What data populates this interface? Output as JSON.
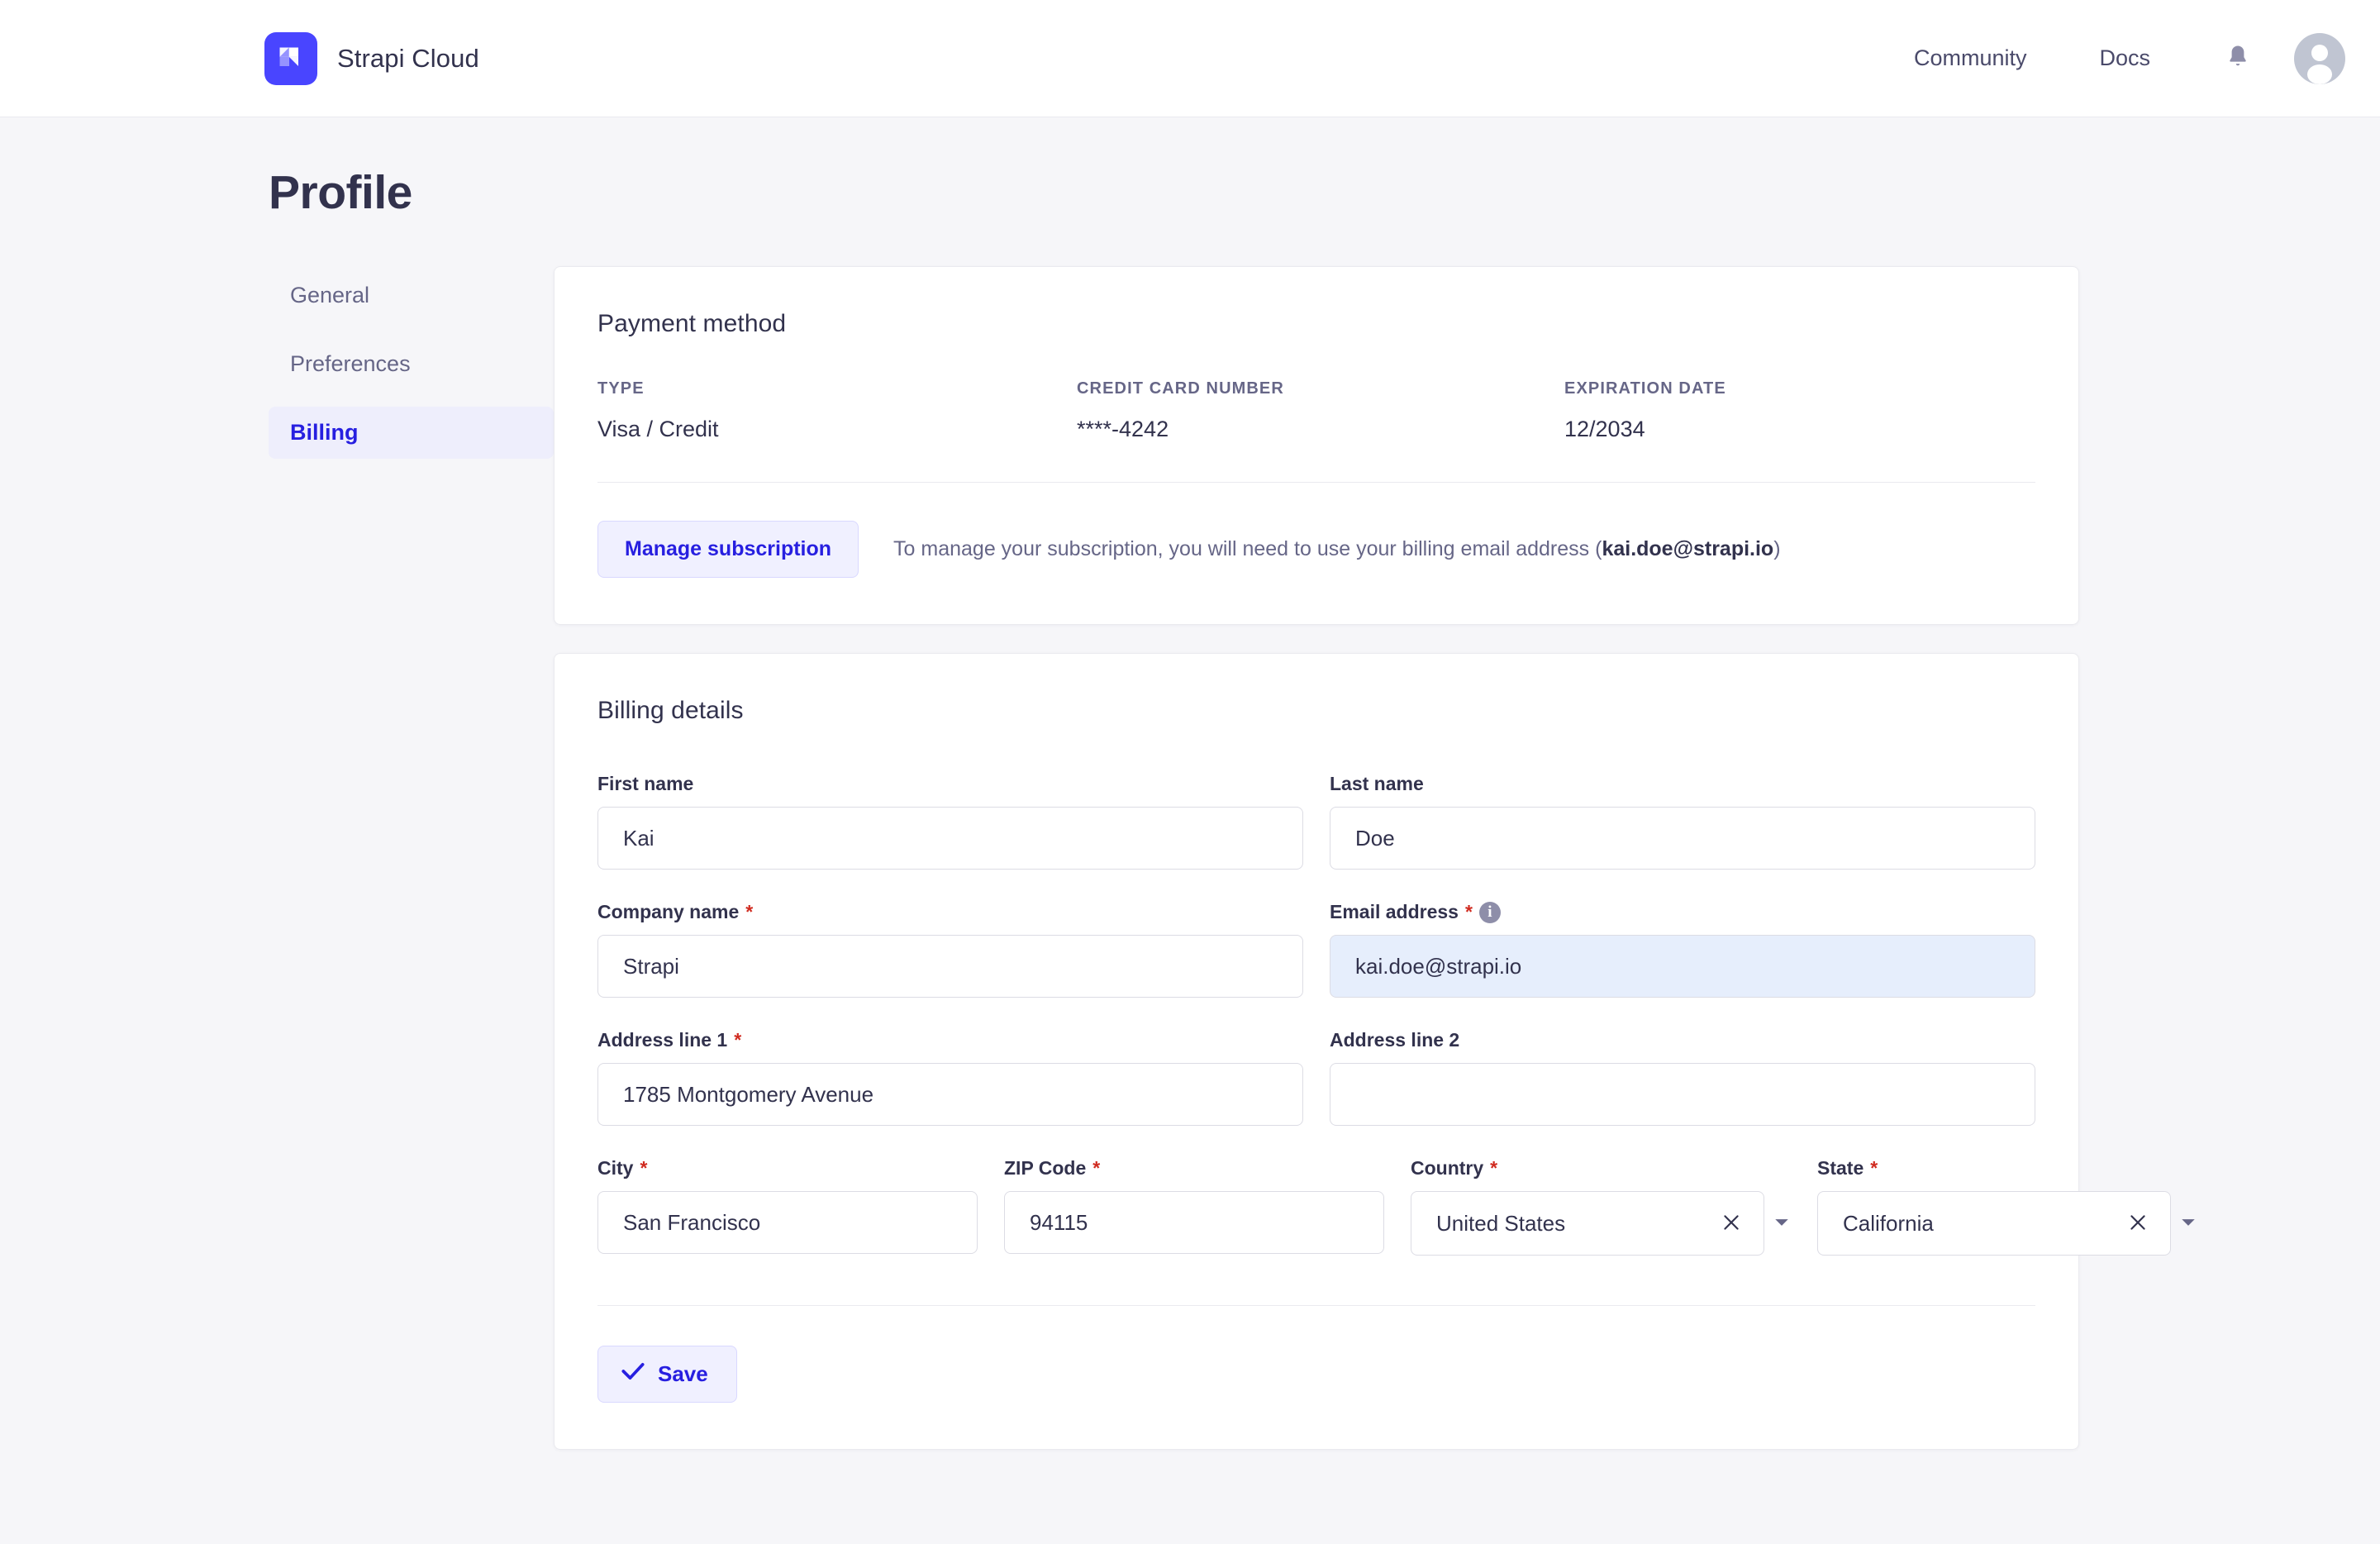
{
  "topbar": {
    "brand_name": "Strapi Cloud",
    "logo_color": "#4945ff",
    "links": [
      {
        "label": "Community"
      },
      {
        "label": "Docs"
      }
    ],
    "notifications_icon": "bell-icon",
    "avatar_icon": "user-avatar-icon"
  },
  "page": {
    "title": "Profile"
  },
  "sidebar": {
    "items": [
      {
        "label": "General",
        "active": false
      },
      {
        "label": "Preferences",
        "active": false
      },
      {
        "label": "Billing",
        "active": true
      }
    ],
    "active_color": "#271fe0",
    "active_background": "#eeeefc"
  },
  "payment_method": {
    "title": "Payment method",
    "columns": [
      {
        "label": "TYPE",
        "value": "Visa / Credit"
      },
      {
        "label": "CREDIT CARD NUMBER",
        "value": "****-4242"
      },
      {
        "label": "EXPIRATION DATE",
        "value": "12/2034"
      }
    ],
    "manage_button": "Manage subscription",
    "manage_text_prefix": "To manage your subscription, you will need to use your billing email address (",
    "manage_text_email": "kai.doe@strapi.io",
    "manage_text_suffix": ")"
  },
  "billing_details": {
    "title": "Billing details",
    "fields": {
      "first_name": {
        "label": "First name",
        "value": "Kai",
        "required": false,
        "placeholder": ""
      },
      "last_name": {
        "label": "Last name",
        "value": "Doe",
        "required": false,
        "placeholder": ""
      },
      "company_name": {
        "label": "Company name",
        "required_mark": "*",
        "value": "Strapi",
        "placeholder": ""
      },
      "email_address": {
        "label": "Email address",
        "required_mark": "*",
        "value": "kai.doe@strapi.io",
        "disabled": true,
        "info_icon": "info-icon"
      },
      "address_line_1": {
        "label": "Address line 1",
        "required_mark": "*",
        "value": "1785 Montgomery Avenue",
        "placeholder": ""
      },
      "address_line_2": {
        "label": "Address line 2",
        "value": "",
        "placeholder": ""
      },
      "city": {
        "label": "City",
        "required_mark": "*",
        "value": "San Francisco",
        "placeholder": ""
      },
      "zip_code": {
        "label": "ZIP Code",
        "required_mark": "*",
        "value": "94115",
        "placeholder": ""
      },
      "country": {
        "label": "Country",
        "required_mark": "*",
        "value": "United States"
      },
      "state": {
        "label": "State",
        "required_mark": "*",
        "value": "California"
      }
    },
    "save_button": "Save"
  }
}
